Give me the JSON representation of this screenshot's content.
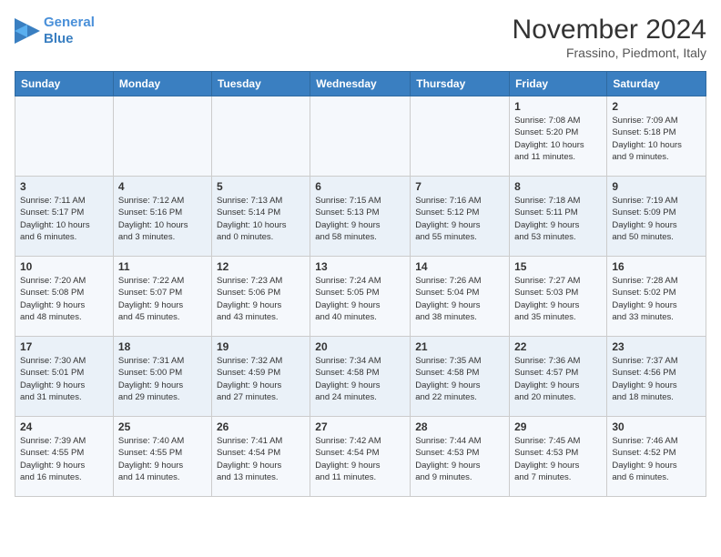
{
  "header": {
    "logo_line1": "General",
    "logo_line2": "Blue",
    "month": "November 2024",
    "location": "Frassino, Piedmont, Italy"
  },
  "weekdays": [
    "Sunday",
    "Monday",
    "Tuesday",
    "Wednesday",
    "Thursday",
    "Friday",
    "Saturday"
  ],
  "weeks": [
    [
      {
        "day": "",
        "info": ""
      },
      {
        "day": "",
        "info": ""
      },
      {
        "day": "",
        "info": ""
      },
      {
        "day": "",
        "info": ""
      },
      {
        "day": "",
        "info": ""
      },
      {
        "day": "1",
        "info": "Sunrise: 7:08 AM\nSunset: 5:20 PM\nDaylight: 10 hours\nand 11 minutes."
      },
      {
        "day": "2",
        "info": "Sunrise: 7:09 AM\nSunset: 5:18 PM\nDaylight: 10 hours\nand 9 minutes."
      }
    ],
    [
      {
        "day": "3",
        "info": "Sunrise: 7:11 AM\nSunset: 5:17 PM\nDaylight: 10 hours\nand 6 minutes."
      },
      {
        "day": "4",
        "info": "Sunrise: 7:12 AM\nSunset: 5:16 PM\nDaylight: 10 hours\nand 3 minutes."
      },
      {
        "day": "5",
        "info": "Sunrise: 7:13 AM\nSunset: 5:14 PM\nDaylight: 10 hours\nand 0 minutes."
      },
      {
        "day": "6",
        "info": "Sunrise: 7:15 AM\nSunset: 5:13 PM\nDaylight: 9 hours\nand 58 minutes."
      },
      {
        "day": "7",
        "info": "Sunrise: 7:16 AM\nSunset: 5:12 PM\nDaylight: 9 hours\nand 55 minutes."
      },
      {
        "day": "8",
        "info": "Sunrise: 7:18 AM\nSunset: 5:11 PM\nDaylight: 9 hours\nand 53 minutes."
      },
      {
        "day": "9",
        "info": "Sunrise: 7:19 AM\nSunset: 5:09 PM\nDaylight: 9 hours\nand 50 minutes."
      }
    ],
    [
      {
        "day": "10",
        "info": "Sunrise: 7:20 AM\nSunset: 5:08 PM\nDaylight: 9 hours\nand 48 minutes."
      },
      {
        "day": "11",
        "info": "Sunrise: 7:22 AM\nSunset: 5:07 PM\nDaylight: 9 hours\nand 45 minutes."
      },
      {
        "day": "12",
        "info": "Sunrise: 7:23 AM\nSunset: 5:06 PM\nDaylight: 9 hours\nand 43 minutes."
      },
      {
        "day": "13",
        "info": "Sunrise: 7:24 AM\nSunset: 5:05 PM\nDaylight: 9 hours\nand 40 minutes."
      },
      {
        "day": "14",
        "info": "Sunrise: 7:26 AM\nSunset: 5:04 PM\nDaylight: 9 hours\nand 38 minutes."
      },
      {
        "day": "15",
        "info": "Sunrise: 7:27 AM\nSunset: 5:03 PM\nDaylight: 9 hours\nand 35 minutes."
      },
      {
        "day": "16",
        "info": "Sunrise: 7:28 AM\nSunset: 5:02 PM\nDaylight: 9 hours\nand 33 minutes."
      }
    ],
    [
      {
        "day": "17",
        "info": "Sunrise: 7:30 AM\nSunset: 5:01 PM\nDaylight: 9 hours\nand 31 minutes."
      },
      {
        "day": "18",
        "info": "Sunrise: 7:31 AM\nSunset: 5:00 PM\nDaylight: 9 hours\nand 29 minutes."
      },
      {
        "day": "19",
        "info": "Sunrise: 7:32 AM\nSunset: 4:59 PM\nDaylight: 9 hours\nand 27 minutes."
      },
      {
        "day": "20",
        "info": "Sunrise: 7:34 AM\nSunset: 4:58 PM\nDaylight: 9 hours\nand 24 minutes."
      },
      {
        "day": "21",
        "info": "Sunrise: 7:35 AM\nSunset: 4:58 PM\nDaylight: 9 hours\nand 22 minutes."
      },
      {
        "day": "22",
        "info": "Sunrise: 7:36 AM\nSunset: 4:57 PM\nDaylight: 9 hours\nand 20 minutes."
      },
      {
        "day": "23",
        "info": "Sunrise: 7:37 AM\nSunset: 4:56 PM\nDaylight: 9 hours\nand 18 minutes."
      }
    ],
    [
      {
        "day": "24",
        "info": "Sunrise: 7:39 AM\nSunset: 4:55 PM\nDaylight: 9 hours\nand 16 minutes."
      },
      {
        "day": "25",
        "info": "Sunrise: 7:40 AM\nSunset: 4:55 PM\nDaylight: 9 hours\nand 14 minutes."
      },
      {
        "day": "26",
        "info": "Sunrise: 7:41 AM\nSunset: 4:54 PM\nDaylight: 9 hours\nand 13 minutes."
      },
      {
        "day": "27",
        "info": "Sunrise: 7:42 AM\nSunset: 4:54 PM\nDaylight: 9 hours\nand 11 minutes."
      },
      {
        "day": "28",
        "info": "Sunrise: 7:44 AM\nSunset: 4:53 PM\nDaylight: 9 hours\nand 9 minutes."
      },
      {
        "day": "29",
        "info": "Sunrise: 7:45 AM\nSunset: 4:53 PM\nDaylight: 9 hours\nand 7 minutes."
      },
      {
        "day": "30",
        "info": "Sunrise: 7:46 AM\nSunset: 4:52 PM\nDaylight: 9 hours\nand 6 minutes."
      }
    ]
  ]
}
